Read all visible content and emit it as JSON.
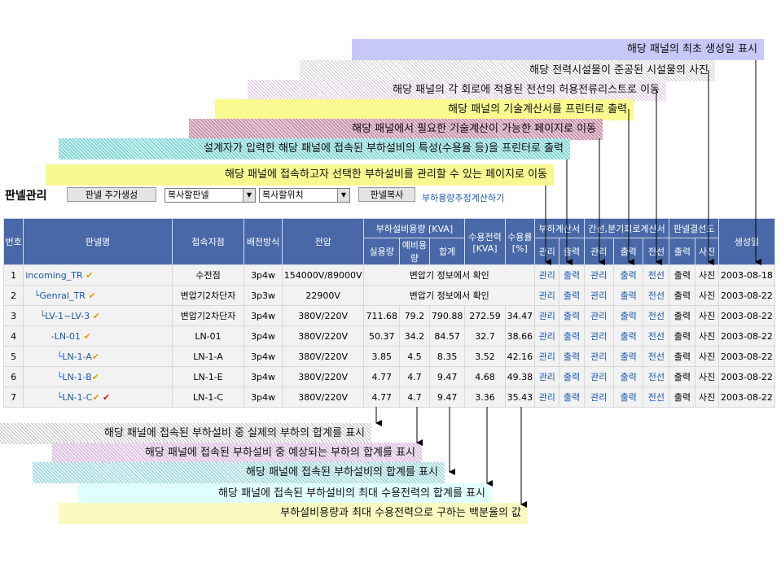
{
  "callouts_top": [
    "해당 패널의 최초 생성일 표시",
    "해당 전력시설물이 준공된 시설물의 사진",
    "해당 패널의 각 회로에 적용된 전선의 허용전류리스트로 이동",
    "해당 패널의 기술계산서를 프린터로 출력",
    "해당 패널에서 필요한 기술계산이 가능한 페이지로 이동",
    "설계자가 입력한 해당 패널에 접속된 부하설비의 특성(수용율 등)을 프린터로 출력",
    "해당 패널에 접속하고자 선택한 부하설비를 관리할 수 있는 페이지로 이동"
  ],
  "callouts_bottom": [
    "해당 패널에 접속된 부하설비 중 실제의 부하의 합계를 표시",
    "해당 패널에 접속된 부하설비 중 예상되는 부하의 합계를 표시",
    "해당 패널에 접속된 부하설비의 합계를 표시",
    "해당 패널에 접속된 부하설비의 최대 수용전력의 합계를 표시",
    "부하설비용량과 최대 수용전력으로 구하는 백분율의 값"
  ],
  "toolbar": {
    "title": "판넬관리",
    "add_button": "판넬 추가생성",
    "copy_panel_select": "복사할판넬",
    "copy_position_select": "복사할위치",
    "copy_button": "판넬복사",
    "calc_link": "부하용량추정계산하기"
  },
  "table": {
    "headers": {
      "no": "번호",
      "name": "판넬명",
      "connection": "접속지점",
      "method": "배전방식",
      "voltage": "전압",
      "load_capacity": "부하설비용량 [KVA]",
      "actual": "실용량",
      "spare": "예비용량",
      "sum": "합계",
      "demand_power": "수용전력 [KVA]",
      "demand_rate": "수용률 [%]",
      "load_calc": "부하계산서",
      "trunk_calc": "간선,분기회로계산서",
      "panel_diagram": "판넬결선도",
      "created": "생성일",
      "manage": "관리",
      "print": "출력",
      "wire": "전선",
      "photo": "사진"
    },
    "rows": [
      {
        "no": "1",
        "name": "incoming_TR",
        "conn": "수전점",
        "method": "3p4w",
        "voltage": "154000V/89000V",
        "merged": "변압기 정보에서 확인",
        "date": "2003-08-18",
        "mark": "✔"
      },
      {
        "no": "2",
        "name": "└Genral_TR",
        "conn": "변압기2차단자",
        "method": "3p3w",
        "voltage": "22900V",
        "merged": "변압기 정보에서 확인",
        "date": "2003-08-22",
        "mark": "✔"
      },
      {
        "no": "3",
        "name": "└LV-1~LV-3",
        "conn": "변압기2차단자",
        "method": "3p4w",
        "voltage": "380V/220V",
        "actual": "711.68",
        "spare": "79.2",
        "sum": "790.88",
        "demand": "272.59",
        "rate": "34.47",
        "date": "2003-08-22",
        "mark": "✔"
      },
      {
        "no": "4",
        "name": "-LN-01",
        "conn": "LN-01",
        "method": "3p4w",
        "voltage": "380V/220V",
        "actual": "50.37",
        "spare": "34.2",
        "sum": "84.57",
        "demand": "32.7",
        "rate": "38.66",
        "date": "2003-08-22",
        "mark": "✔"
      },
      {
        "no": "5",
        "name": "└LN-1-A",
        "conn": "LN-1-A",
        "method": "3p4w",
        "voltage": "380V/220V",
        "actual": "3.85",
        "spare": "4.5",
        "sum": "8.35",
        "demand": "3.52",
        "rate": "42.16",
        "date": "2003-08-22",
        "mark": "✔"
      },
      {
        "no": "6",
        "name": "└LN-1-B",
        "conn": "LN-1-E",
        "method": "3p4w",
        "voltage": "380V/220V",
        "actual": "4.77",
        "spare": "4.7",
        "sum": "9.47",
        "demand": "4.68",
        "rate": "49.38",
        "date": "2003-08-22",
        "mark": "✔"
      },
      {
        "no": "7",
        "name": "└LN-1-C",
        "conn": "LN-1-C",
        "method": "3p4w",
        "voltage": "380V/220V",
        "actual": "4.77",
        "spare": "4.7",
        "sum": "9.47",
        "demand": "3.36",
        "rate": "35.43",
        "date": "2003-08-22",
        "mark": "✔",
        "mark2": "✔"
      }
    ]
  }
}
